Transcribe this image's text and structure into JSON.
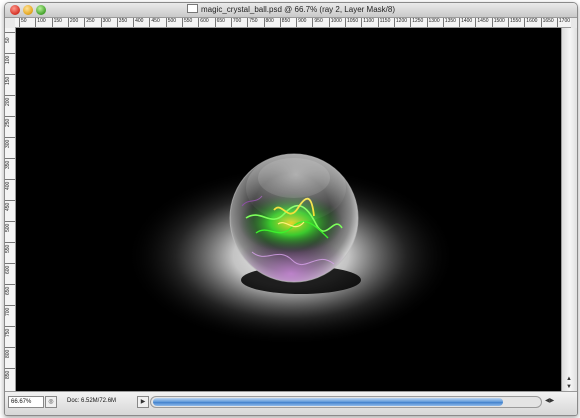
{
  "window": {
    "title": "magic_crystal_ball.psd @ 66.7% (ray 2, Layer Mask/8)"
  },
  "rulers": {
    "top_ticks": [
      "50",
      "100",
      "150",
      "200",
      "250",
      "300",
      "350",
      "400",
      "450",
      "500",
      "550",
      "600",
      "650",
      "700",
      "750",
      "800",
      "850",
      "900",
      "950",
      "1000",
      "1050",
      "1100",
      "1150",
      "1200",
      "1250",
      "1300",
      "1350",
      "1400",
      "1450",
      "1500",
      "1550",
      "1600",
      "1650",
      "1700"
    ],
    "left_ticks": [
      "50",
      "100",
      "150",
      "200",
      "250",
      "300",
      "350",
      "400",
      "450",
      "500",
      "550",
      "600",
      "650",
      "700",
      "750",
      "800",
      "850"
    ]
  },
  "status": {
    "zoom": "66.67%",
    "doc_info": "Doc: 6.52M/72.6M",
    "play_icon": "play-icon"
  },
  "icons": {
    "doc": "document-icon",
    "nav": "navigator-icon"
  },
  "colors": {
    "canvas": "#000000",
    "glow_green": "#3df02c",
    "glow_yellow": "#f3dd2b",
    "glow_purple": "#9a4bb7",
    "scroll_blue": "#4f8ed6"
  }
}
